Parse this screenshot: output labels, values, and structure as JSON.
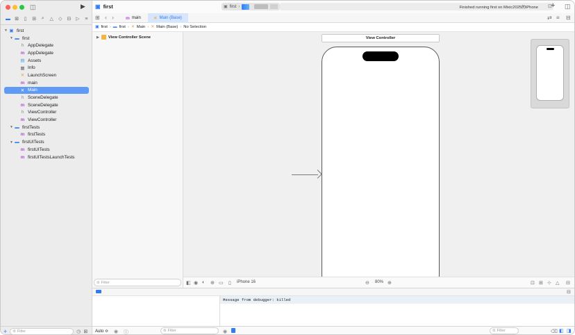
{
  "navigator": {
    "traffic_lights": {
      "close": "#ff5f57",
      "minimize": "#febc2e",
      "zoom": "#28c840"
    },
    "tabs": [
      "folder-icon",
      "source-control-icon",
      "bookmark-icon",
      "hierarchy-icon",
      "search-icon",
      "warning-icon",
      "test-icon",
      "debug-icon",
      "breakpoint-icon",
      "report-icon"
    ],
    "tree": [
      {
        "label": "first",
        "level": 0,
        "icon": "project-icon",
        "expanded": true
      },
      {
        "label": "first",
        "level": 1,
        "icon": "folder-icon",
        "expanded": true
      },
      {
        "label": "AppDelegate",
        "level": 2,
        "icon": "header-file-icon"
      },
      {
        "label": "AppDelegate",
        "level": 2,
        "icon": "objc-file-icon"
      },
      {
        "label": "Assets",
        "level": 2,
        "icon": "assets-icon"
      },
      {
        "label": "Info",
        "level": 2,
        "icon": "plist-icon"
      },
      {
        "label": "LaunchScreen",
        "level": 2,
        "icon": "storyboard-icon"
      },
      {
        "label": "main",
        "level": 2,
        "icon": "objc-file-icon"
      },
      {
        "label": "Main",
        "level": 2,
        "icon": "storyboard-icon",
        "selected": true
      },
      {
        "label": "SceneDelegate",
        "level": 2,
        "icon": "header-file-icon"
      },
      {
        "label": "SceneDelegate",
        "level": 2,
        "icon": "objc-file-icon"
      },
      {
        "label": "ViewController",
        "level": 2,
        "icon": "header-file-icon"
      },
      {
        "label": "ViewController",
        "level": 2,
        "icon": "objc-file-icon"
      },
      {
        "label": "firstTests",
        "level": 1,
        "icon": "folder-icon",
        "expanded": true
      },
      {
        "label": "firstTests",
        "level": 2,
        "icon": "objc-file-icon"
      },
      {
        "label": "firstUITests",
        "level": 1,
        "icon": "folder-icon",
        "expanded": true
      },
      {
        "label": "firstUITests",
        "level": 2,
        "icon": "objc-file-icon"
      },
      {
        "label": "firstUITestsLaunchTests",
        "level": 2,
        "icon": "objc-file-icon"
      }
    ],
    "filter_placeholder": "Filter"
  },
  "toolbar": {
    "project_title": "first",
    "scheme_name": "first",
    "status": "Finished running first on Mixic2025的iPhone"
  },
  "tabs": [
    {
      "label": "main",
      "active": false
    },
    {
      "label": "Main (Base)",
      "active": true
    }
  ],
  "jumpbar": [
    "first",
    "first",
    "Main",
    "Main (Base)",
    "No Selection"
  ],
  "outline": {
    "scene_label": "View Controller Scene",
    "filter_placeholder": "Filter"
  },
  "canvas": {
    "view_controller_title": "View Controller",
    "device": "iPhone 16",
    "zoom": "80%"
  },
  "debug": {
    "variables_mode": "Auto ≎",
    "filter_placeholder": "Filter",
    "console_message": "Message from debugger: killed",
    "console_filter_placeholder": "Filter"
  }
}
